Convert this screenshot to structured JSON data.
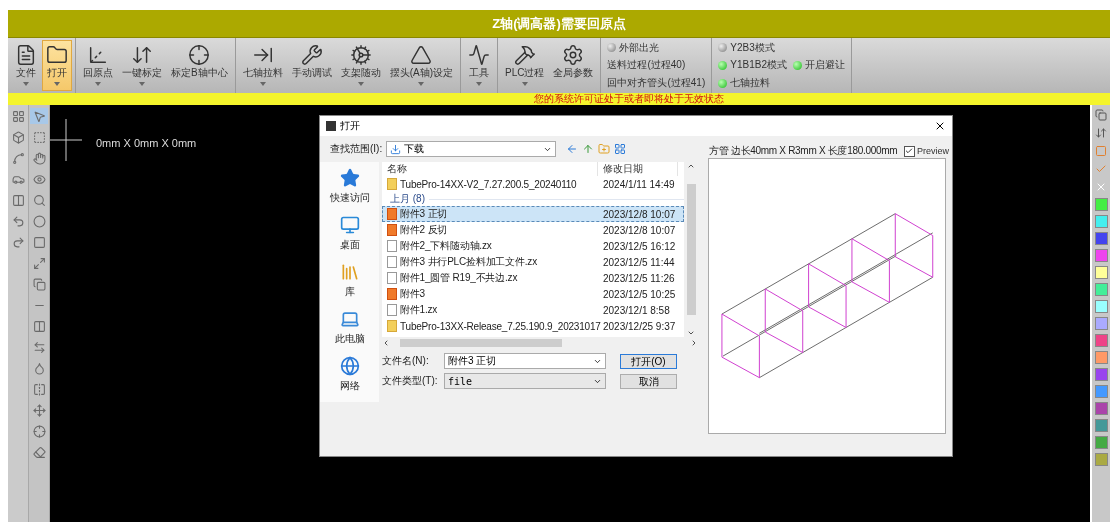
{
  "title": "Z轴(调高器)需要回原点",
  "ribbon": {
    "groups": [
      {
        "buttons": [
          {
            "label": "文件",
            "has_menu": true,
            "selected": false
          },
          {
            "label": "打开",
            "has_menu": true,
            "selected": true
          }
        ]
      },
      {
        "buttons": [
          {
            "label": "回原点",
            "has_menu": true,
            "selected": false
          },
          {
            "label": "一键标定",
            "has_menu": true,
            "selected": false
          },
          {
            "label": "标定B轴中心",
            "has_menu": false,
            "selected": false
          }
        ]
      },
      {
        "buttons": [
          {
            "label": "七轴拉料",
            "has_menu": true,
            "selected": false
          },
          {
            "label": "手动调试",
            "has_menu": false,
            "selected": false
          },
          {
            "label": "支架随动",
            "has_menu": true,
            "selected": false
          },
          {
            "label": "摆头(A轴)设定",
            "has_menu": true,
            "selected": false
          }
        ]
      },
      {
        "buttons": [
          {
            "label": "工具",
            "has_menu": true,
            "selected": false
          }
        ]
      },
      {
        "buttons": [
          {
            "label": "PLC过程",
            "has_menu": true,
            "selected": false
          },
          {
            "label": "全局参数",
            "has_menu": false,
            "selected": false
          }
        ]
      }
    ]
  },
  "status_groups": [
    {
      "rows": [
        [
          {
            "kind": "led",
            "label": "外部出光",
            "on": false
          }
        ],
        [
          {
            "kind": "text",
            "label": "送料过程(过程40)"
          }
        ],
        [
          {
            "kind": "text",
            "label": "回中对齐管头(过程41)"
          }
        ]
      ]
    },
    {
      "rows": [
        [
          {
            "kind": "led",
            "label": "Y2B3模式",
            "on": false
          }
        ],
        [
          {
            "kind": "led",
            "label": "Y1B1B2模式",
            "on": true
          },
          {
            "kind": "led",
            "label": "开启避让",
            "on": true
          }
        ],
        [
          {
            "kind": "led",
            "label": "七轴拉料",
            "on": true
          }
        ]
      ]
    }
  ],
  "warning": "您的系统许可证处于或者即将处于无效状态",
  "canvas": {
    "readout": "0mm X 0mm X 0mm"
  },
  "dialog": {
    "title": "打开",
    "look_in": {
      "label": "查找范围(I):",
      "value": "下载"
    },
    "places": [
      {
        "kind": "star",
        "label": "快速访问"
      },
      {
        "kind": "desktop",
        "label": "桌面"
      },
      {
        "kind": "library",
        "label": "库"
      },
      {
        "kind": "computer",
        "label": "此电脑"
      },
      {
        "kind": "network",
        "label": "网络"
      }
    ],
    "list": {
      "columns": [
        "名称",
        "修改日期"
      ],
      "top_rows": [
        {
          "kind": "folder",
          "name": "TubePro-14XX-V2_7.27.200.5_20240110",
          "date": "2024/1/11 14:49",
          "selected": false
        }
      ],
      "groups": [
        {
          "label": "上月 (8)",
          "rows": [
            {
              "kind": "job",
              "name": "附件3 正切",
              "date": "2023/12/8 10:07",
              "selected": true
            },
            {
              "kind": "job",
              "name": "附件2 反切",
              "date": "2023/12/8 10:07",
              "selected": false
            },
            {
              "kind": "file",
              "name": "附件2_下料随动轴.zx",
              "date": "2023/12/5 16:12",
              "selected": false
            },
            {
              "kind": "file",
              "name": "附件3 井行PLC捡料加工文件.zx",
              "date": "2023/12/5 11:44",
              "selected": false
            },
            {
              "kind": "file",
              "name": "附件1_圆管 R19_不共边.zx",
              "date": "2023/12/5 11:26",
              "selected": false
            },
            {
              "kind": "job",
              "name": "附件3",
              "date": "2023/12/5 10:25",
              "selected": false
            },
            {
              "kind": "file",
              "name": "附件1.zx",
              "date": "2023/12/1 8:58",
              "selected": false
            },
            {
              "kind": "folder",
              "name": "TubePro-13XX-Release_7.25.190.9_20231017",
              "date": "2023/12/25 9:37",
              "selected": false
            }
          ]
        }
      ]
    },
    "filename": {
      "label": "文件名(N):",
      "value": "附件3 正切"
    },
    "filetype": {
      "label": "文件类型(T):",
      "value": "file"
    },
    "buttons": [
      "打开(O)",
      "取消"
    ],
    "preview": {
      "caption": "方管 边长40mm X R3mm X 长度180.000mm",
      "checkbox": {
        "label": "Preview",
        "checked": true
      }
    }
  },
  "palette": {
    "swatches": [
      {
        "color": "#44ee44"
      },
      {
        "color": "#44eeee"
      },
      {
        "color": "#4444ee"
      },
      {
        "color": "#ee44ee"
      },
      {
        "color": "#ffff99"
      },
      {
        "color": "#44ee99"
      },
      {
        "color": "#99ffff"
      },
      {
        "color": "#aaaaff"
      },
      {
        "color": "#ee4488"
      },
      {
        "color": "#ff9966"
      },
      {
        "color": "#9944ee"
      },
      {
        "color": "#4499ff"
      },
      {
        "color": "#aa44aa"
      },
      {
        "color": "#449999"
      },
      {
        "color": "#44aa44"
      },
      {
        "color": "#aaaa44"
      }
    ]
  }
}
